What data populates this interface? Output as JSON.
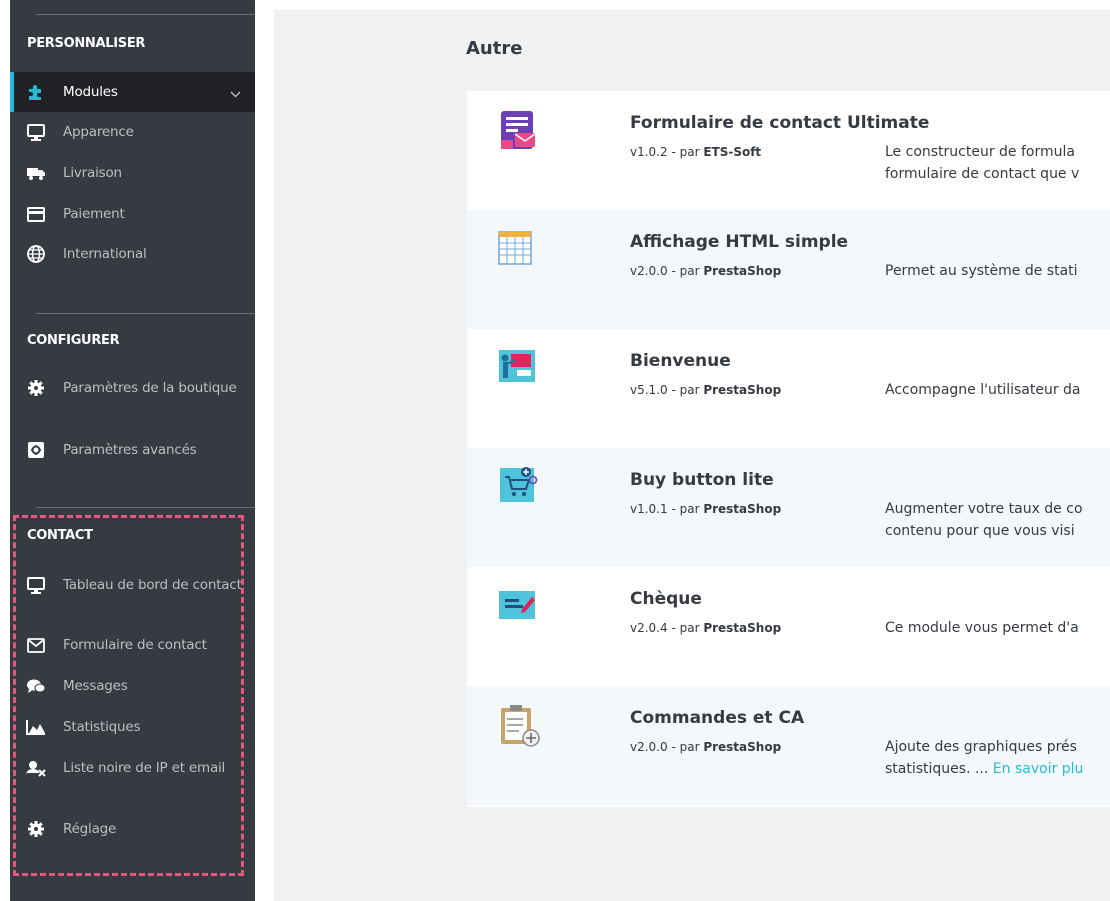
{
  "sidebar": {
    "sections": [
      {
        "title": "PERSONNALISER",
        "items": [
          {
            "label": "Modules",
            "icon": "puzzle-icon",
            "active": true
          },
          {
            "label": "Apparence",
            "icon": "monitor-icon"
          },
          {
            "label": "Livraison",
            "icon": "truck-icon"
          },
          {
            "label": "Paiement",
            "icon": "credit-card-icon"
          },
          {
            "label": "International",
            "icon": "globe-icon"
          }
        ]
      },
      {
        "title": "CONFIGURER",
        "items": [
          {
            "label": "Paramètres de la boutique",
            "icon": "gear-icon"
          },
          {
            "label": "Paramètres avancés",
            "icon": "advanced-settings-icon"
          }
        ]
      },
      {
        "title": "CONTACT",
        "items": [
          {
            "label": "Tableau de bord de contact",
            "icon": "monitor-icon"
          },
          {
            "label": "Formulaire de contact",
            "icon": "envelope-icon"
          },
          {
            "label": "Messages",
            "icon": "chat-icon"
          },
          {
            "label": "Statistiques",
            "icon": "area-chart-icon"
          },
          {
            "label": "Liste noire de IP et email",
            "icon": "user-block-icon"
          },
          {
            "label": "Réglage",
            "icon": "gear-icon"
          }
        ]
      }
    ]
  },
  "main": {
    "heading": "Autre",
    "modules": [
      {
        "name": "Formulaire de contact Ultimate",
        "version": "v1.0.2 - par ",
        "author": "ETS-Soft",
        "desc_lines": [
          "Le constructeur de formula",
          "formulaire de contact que v"
        ],
        "icon": "contact-form-logo-icon"
      },
      {
        "name": "Affichage HTML simple",
        "version": "v2.0.0 - par ",
        "author": "PrestaShop",
        "desc_lines": [
          "Permet au système de stati"
        ],
        "icon": "table-logo-icon"
      },
      {
        "name": "Bienvenue",
        "version": "v5.1.0 - par ",
        "author": "PrestaShop",
        "desc_lines": [
          "Accompagne l'utilisateur da"
        ],
        "icon": "presentation-logo-icon"
      },
      {
        "name": "Buy button lite",
        "version": "v1.0.1 - par ",
        "author": "PrestaShop",
        "desc_lines": [
          "Augmenter votre taux de co",
          "contenu pour que vous visi"
        ],
        "icon": "cart-logo-icon"
      },
      {
        "name": "Chèque",
        "version": "v2.0.4 - par ",
        "author": "PrestaShop",
        "desc_lines": [
          "Ce module vous permet d'a"
        ],
        "icon": "cheque-logo-icon"
      },
      {
        "name": "Commandes et CA",
        "version": "v2.0.0 - par ",
        "author": "PrestaShop",
        "desc_lines": [
          "Ajoute des graphiques prés",
          "statistiques. ... "
        ],
        "link": "En savoir plu",
        "icon": "clipboard-logo-icon"
      }
    ]
  },
  "colors": {
    "sidebar_bg": "#363a41",
    "active_bg": "#202226",
    "accent": "#25b9d7",
    "highlight_dash": "#e8557f"
  }
}
